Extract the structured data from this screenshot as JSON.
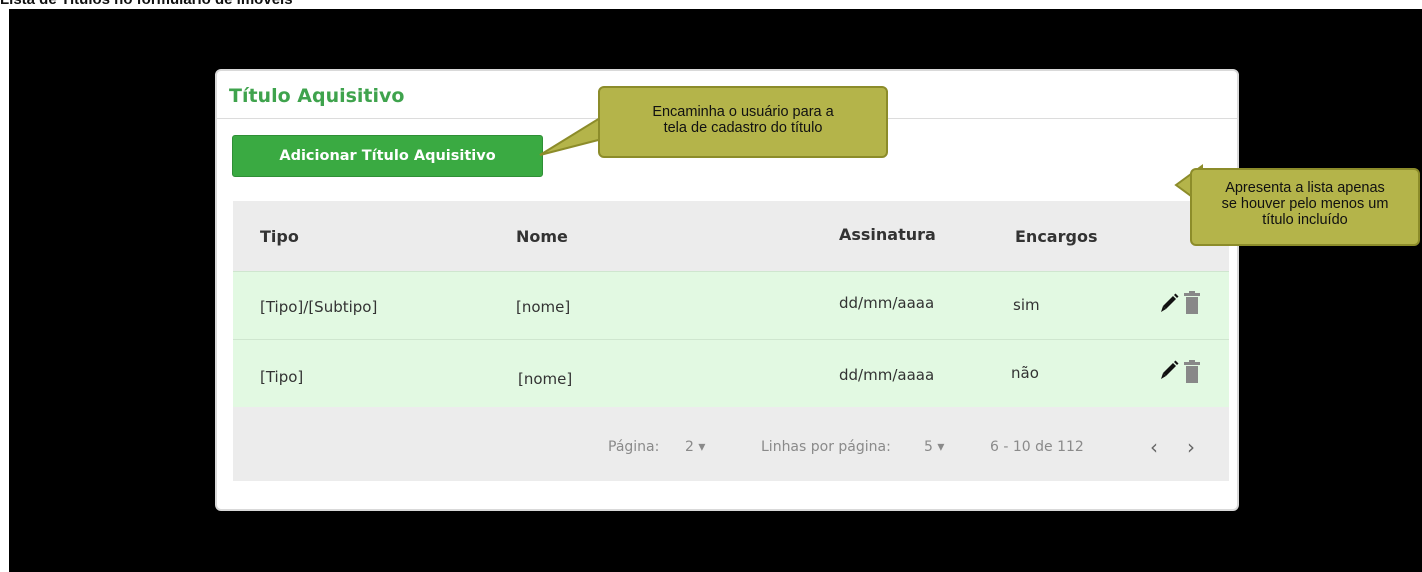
{
  "page": {
    "heading": "Lista de Títulos no formulário de imóveis"
  },
  "panel": {
    "title": "Título Aquisitivo",
    "add_button_label": "Adicionar Título Aquisitivo"
  },
  "table": {
    "columns": [
      "Tipo",
      "Nome",
      "Assinatura",
      "Encargos"
    ],
    "rows": [
      {
        "tipo": "[Tipo]/[Subtipo]",
        "nome": "[nome]",
        "assinatura": "dd/mm/aaaa",
        "encargos": "sim"
      },
      {
        "tipo": "[Tipo]",
        "nome": "[nome]",
        "assinatura": "dd/mm/aaaa",
        "encargos": "não"
      }
    ],
    "row_icons": [
      "pencil-icon",
      "trash-icon"
    ]
  },
  "pagination": {
    "page_label": "Página:",
    "page_value": "2",
    "rows_label": "Linhas por página:",
    "rows_value": "5",
    "range_text": "6 - 10 de 112",
    "prev_glyph": "‹",
    "next_glyph": "›"
  },
  "callouts": {
    "button_note": [
      "Encaminha o usuário para a",
      "tela de cadastro do título"
    ],
    "list_note": [
      "Apresenta a lista apenas",
      "se houver pelo menos um",
      "título incluído"
    ]
  },
  "colors": {
    "accent_green": "#3aaa42",
    "title_green": "#3fa34d",
    "row_background": "#e2f9e2",
    "callout_background": "#b4b44a"
  }
}
